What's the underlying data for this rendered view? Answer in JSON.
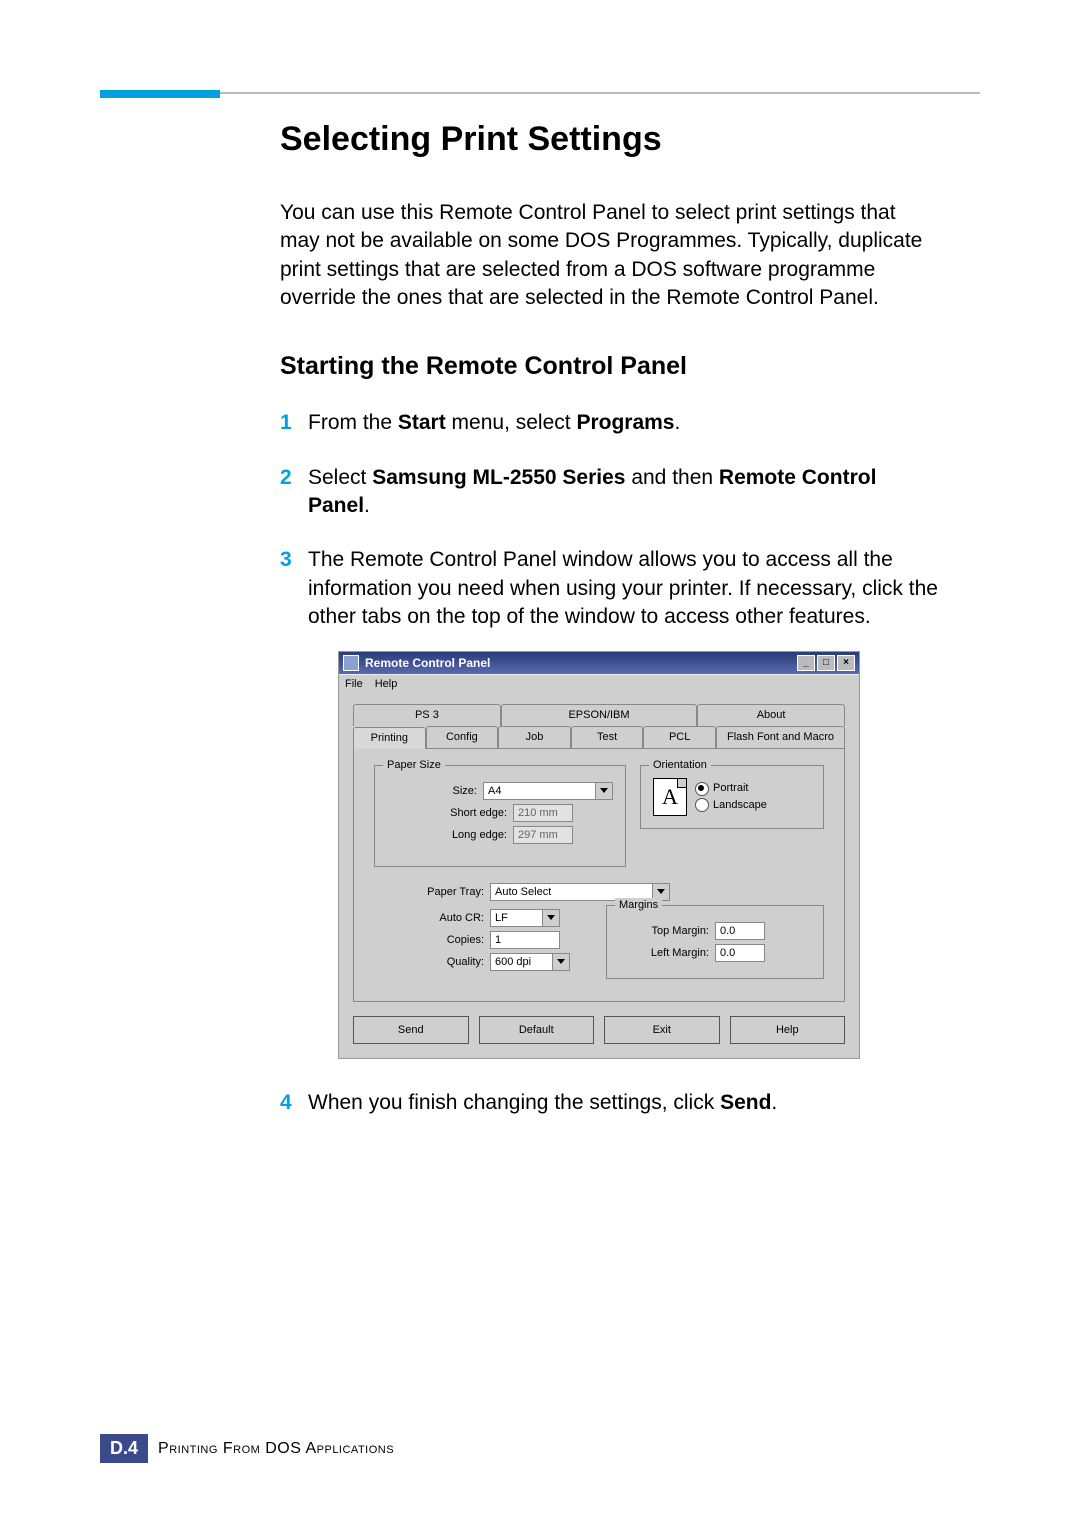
{
  "heading": "Selecting Print Settings",
  "intro": "You can use this Remote Control Panel to select print settings that may not be available on some DOS Programmes. Typically, duplicate print settings that are selected from a DOS software programme override the ones that are selected in the Remote Control Panel.",
  "subheading": "Starting the Remote Control Panel",
  "steps": {
    "s1": {
      "num": "1",
      "a": "From the ",
      "b": "Start",
      "c": " menu, select ",
      "d": "Programs",
      "e": "."
    },
    "s2": {
      "num": "2",
      "a": "Select ",
      "b": "Samsung ML-2550 Series",
      "c": " and then ",
      "d": "Remote Control Panel",
      "e": "."
    },
    "s3": {
      "num": "3",
      "a": "The Remote Control Panel window allows you to access all the information you need when using your printer. If necessary, click the other tabs on the top of the window to access other features."
    },
    "s4": {
      "num": "4",
      "a": "When you finish changing the settings, click ",
      "b": "Send",
      "c": "."
    }
  },
  "footer": {
    "badge_letter": "D.",
    "badge_num": "4",
    "chapter": "Printing From DOS Applications"
  },
  "dialog": {
    "title": "Remote Control Panel",
    "menu": {
      "file": "File",
      "help": "Help"
    },
    "tabs_back": {
      "ps3": "PS 3",
      "epson": "EPSON/IBM",
      "about": "About"
    },
    "tabs_front": {
      "printing": "Printing",
      "config": "Config",
      "job": "Job",
      "test": "Test",
      "pcl": "PCL",
      "flash": "Flash Font and Macro"
    },
    "paper_size": {
      "legend": "Paper Size",
      "size_label": "Size:",
      "size_value": "A4",
      "short_label": "Short edge:",
      "short_value": "210 mm",
      "long_label": "Long edge:",
      "long_value": "297 mm"
    },
    "orientation": {
      "legend": "Orientation",
      "glyph": "A",
      "portrait": "Portrait",
      "landscape": "Landscape"
    },
    "fields": {
      "paper_tray_label": "Paper Tray:",
      "paper_tray_value": "Auto Select",
      "auto_cr_label": "Auto CR:",
      "auto_cr_value": "LF",
      "copies_label": "Copies:",
      "copies_value": "1",
      "quality_label": "Quality:",
      "quality_value": "600 dpi"
    },
    "margins": {
      "legend": "Margins",
      "top_label": "Top Margin:",
      "top_value": "0.0",
      "left_label": "Left Margin:",
      "left_value": "0.0"
    },
    "buttons": {
      "send": "Send",
      "default": "Default",
      "exit": "Exit",
      "help": "Help"
    },
    "win": {
      "min": "_",
      "max": "□",
      "close": "×"
    }
  }
}
